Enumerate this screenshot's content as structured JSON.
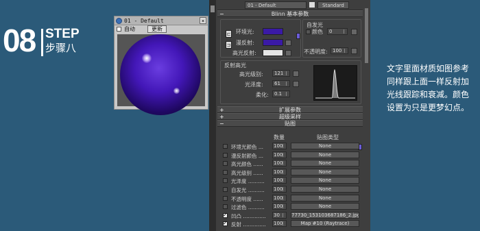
{
  "step": {
    "number": "08",
    "label": "STEP",
    "subtitle": "步骤八"
  },
  "preview_window": {
    "title": "01 - Default",
    "auto_label": "自动",
    "update_label": "更新",
    "close_glyph": "×"
  },
  "editor": {
    "material_name": "01 - Default",
    "material_type": "Standard",
    "blinn_rollout": "Blinn 基本参数",
    "ambient_label": "环境光:",
    "diffuse_label": "漫反射:",
    "specular_label": "高光反射:",
    "self_illum_group": "自发光",
    "color_label": "颜色",
    "self_illum_value": "0",
    "opacity_label": "不透明度:",
    "opacity_value": "100",
    "spec_group": "反射高光",
    "spec_level_label": "高光级别:",
    "spec_level_value": "121",
    "gloss_label": "光泽度:",
    "gloss_value": "61",
    "soften_label": "柔化:",
    "soften_value": "0.1",
    "lock_c": "C",
    "extended_rollout": "扩展参数",
    "supersampling_rollout": "超级采样",
    "maps_rollout": "贴图",
    "maps_amount_header": "数量",
    "maps_type_header": "贴图类型",
    "colors": {
      "ambient": "#3a1aa6",
      "diffuse": "#3a1aa6",
      "specular": "#e6e6e6"
    }
  },
  "maps": [
    {
      "name": "环境光颜色 ...",
      "amount": "100",
      "map": "None",
      "checked": false
    },
    {
      "name": "漫反射颜色 ...",
      "amount": "100",
      "map": "None",
      "checked": false
    },
    {
      "name": "高光颜色 ......",
      "amount": "100",
      "map": "None",
      "checked": false
    },
    {
      "name": "高光级别 ......",
      "amount": "100",
      "map": "None",
      "checked": false
    },
    {
      "name": "光泽度 ..........",
      "amount": "100",
      "map": "None",
      "checked": false
    },
    {
      "name": "自发光 ..........",
      "amount": "100",
      "map": "None",
      "checked": false
    },
    {
      "name": "不透明度 ......",
      "amount": "100",
      "map": "None",
      "checked": false
    },
    {
      "name": "过滤色 ..........",
      "amount": "100",
      "map": "None",
      "checked": false
    },
    {
      "name": "凹凸 ..............",
      "amount": "30",
      "map": "77730_153103687186_2.jpg)",
      "checked": true
    },
    {
      "name": "反射 ..............",
      "amount": "100",
      "map": "Map #10 (Raytrace)",
      "checked": true
    }
  ],
  "description": [
    "文字里面材质如图参考",
    "同样跟上面一样反射加",
    "光线跟踪和衰减。颜色",
    "设置为只是更梦幻点。"
  ]
}
